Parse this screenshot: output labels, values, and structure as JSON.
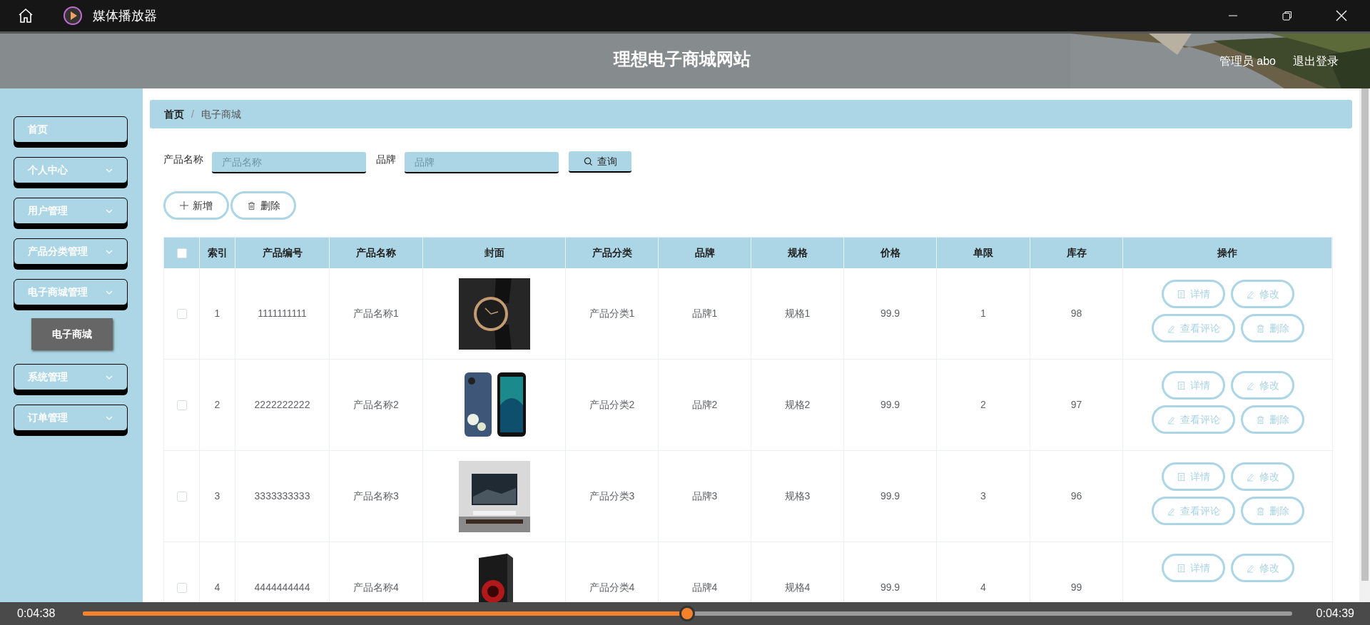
{
  "window": {
    "title": "媒体播放器"
  },
  "site": {
    "title": "理想电子商城网站",
    "user": "管理员 abo",
    "logout": "退出登录"
  },
  "sidebar": {
    "items": [
      {
        "label": "首页",
        "kind": "link"
      },
      {
        "label": "个人中心",
        "kind": "menu"
      },
      {
        "label": "用户管理",
        "kind": "menu"
      },
      {
        "label": "产品分类管理",
        "kind": "menu"
      },
      {
        "label": "电子商城管理",
        "kind": "menu",
        "children": [
          {
            "label": "电子商城",
            "selected": true
          }
        ]
      },
      {
        "label": "系统管理",
        "kind": "menu"
      },
      {
        "label": "订单管理",
        "kind": "menu"
      }
    ]
  },
  "breadcrumb": [
    "首页",
    "/",
    "电子商城"
  ],
  "search": {
    "fields": [
      {
        "label": "产品名称",
        "placeholder": "产品名称"
      },
      {
        "label": "品牌",
        "placeholder": "品牌"
      }
    ],
    "button": "查询"
  },
  "actions": [
    "新增",
    "删除"
  ],
  "table": {
    "all_checked": false,
    "columns": [
      "索引",
      "产品编号",
      "产品名称",
      "封面",
      "产品分类",
      "品牌",
      "规格",
      "价格",
      "单限",
      "库存",
      "操作"
    ],
    "rows": [
      {
        "checked": false,
        "cells": [
          "1",
          "1111111111",
          "产品名称1",
          {
            "kind": "picture"
          },
          "产品分类1",
          "品牌1",
          "规格1",
          "99.9",
          "1",
          "98"
        ],
        "buttons": [
          {
            "label": "详情",
            "kind": "detail"
          },
          {
            "label": "修改",
            "kind": "edit"
          },
          {
            "label": "查看评论",
            "kind": "edit"
          },
          {
            "label": "删除",
            "kind": "delete"
          }
        ]
      },
      {
        "checked": false,
        "cells": [
          "2",
          "2222222222",
          "产品名称2",
          {
            "kind": "picture"
          },
          "产品分类2",
          "品牌2",
          "规格2",
          "99.9",
          "2",
          "97"
        ],
        "buttons": [
          {
            "label": "详情",
            "kind": "detail"
          },
          {
            "label": "修改",
            "kind": "edit"
          },
          {
            "label": "查看评论",
            "kind": "edit"
          },
          {
            "label": "删除",
            "kind": "delete"
          }
        ]
      },
      {
        "checked": false,
        "cells": [
          "3",
          "3333333333",
          "产品名称3",
          {
            "kind": "picture"
          },
          "产品分类3",
          "品牌3",
          "规格3",
          "99.9",
          "3",
          "96"
        ],
        "buttons": [
          {
            "label": "详情",
            "kind": "detail"
          },
          {
            "label": "修改",
            "kind": "edit"
          },
          {
            "label": "查看评论",
            "kind": "edit"
          },
          {
            "label": "删除",
            "kind": "delete"
          }
        ]
      },
      {
        "checked": false,
        "cells": [
          "4",
          "4444444444",
          "产品名称4",
          {
            "kind": "picture"
          },
          "产品分类4",
          "品牌4",
          "规格4",
          "99.9",
          "4",
          "99"
        ],
        "buttons": [
          {
            "label": "详情",
            "kind": "detail"
          },
          {
            "label": "修改",
            "kind": "edit"
          }
        ]
      }
    ]
  },
  "player": {
    "elapsed": "0:04:38",
    "remaining": "0:04:39",
    "level": 0.5
  }
}
